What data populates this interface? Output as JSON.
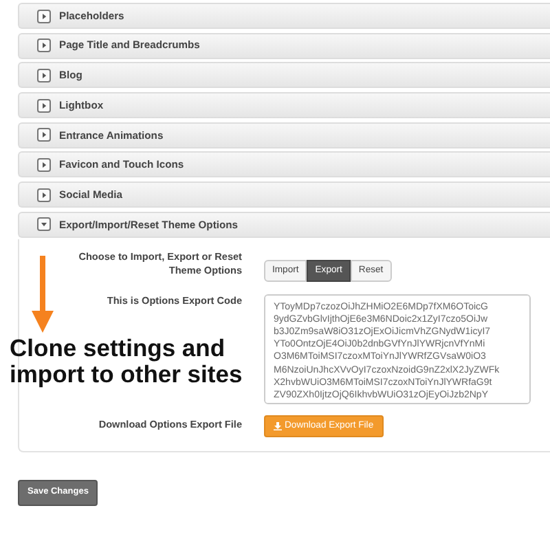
{
  "sections": [
    {
      "title": "Placeholders",
      "expanded": false
    },
    {
      "title": "Page Title and Breadcrumbs",
      "expanded": false
    },
    {
      "title": "Blog",
      "expanded": false
    },
    {
      "title": "Lightbox",
      "expanded": false
    },
    {
      "title": "Entrance Animations",
      "expanded": false
    },
    {
      "title": "Favicon and Touch Icons",
      "expanded": false
    },
    {
      "title": "Social Media",
      "expanded": false
    },
    {
      "title": "Export/Import/Reset Theme Options",
      "expanded": true
    }
  ],
  "panel": {
    "mode_label": "Choose to Import, Export or Reset Theme Options",
    "modes": [
      {
        "label": "Import",
        "selected": false
      },
      {
        "label": "Export",
        "selected": true
      },
      {
        "label": "Reset",
        "selected": false
      }
    ],
    "code_label": "This is Options Export Code",
    "code_lines": [
      "YToyMDp7czozOiJhZHMiO2E6MDp7fXM6OToicG",
      "9ydGZvbGlvIjthOjE6e3M6NDoic2x1ZyI7czo5OiJw",
      "b3J0Zm9saW8iO31zOjExOiJicmVhZGNydW1icyI7",
      "YTo0OntzOjE4OiJ0b2dnbGVfYnJlYWRjcnVfYnMi",
      "O3M6MToiMSI7czoxMToiYnJlYWRfZGVsaW0iO3",
      "M6NzoiUnJhcXVvOyI7czoxNzoidG9nZ2xlX2JyZWFk",
      "X2hvbWUiO3M6MToiMSI7czoxNToiYnJlYWRfaG9t",
      "ZV90ZXh0IjtzOjQ6IkhvbWUiO31zOjEyOiJzb2NpY"
    ],
    "download_label": "Download Options Export File",
    "download_button": "Download Export File"
  },
  "annotation": "Clone settings and import to other sites",
  "save_button": "Save Changes"
}
